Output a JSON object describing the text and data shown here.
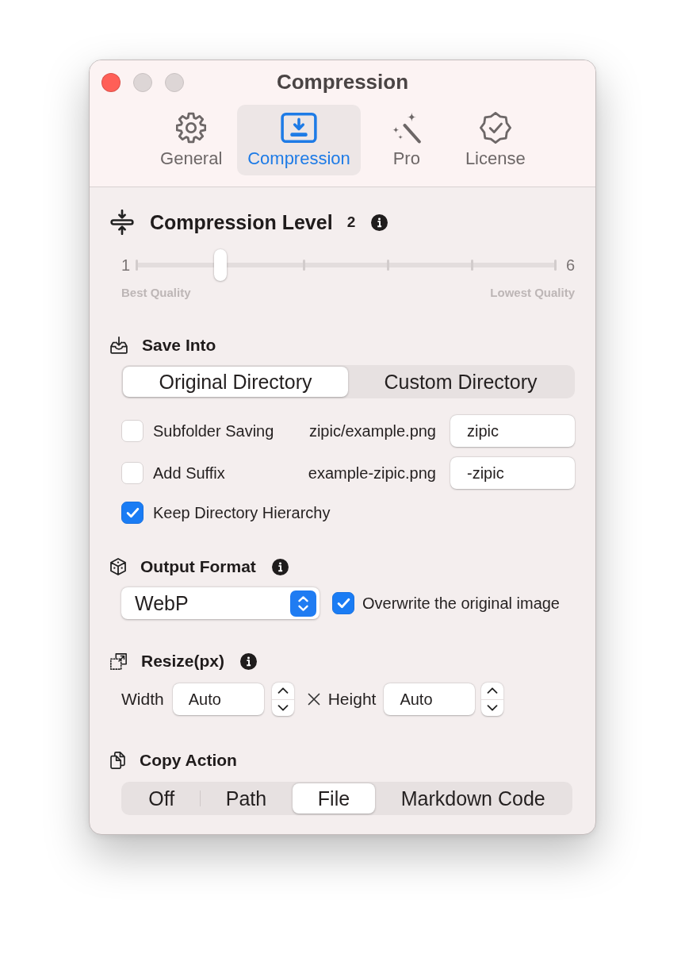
{
  "window": {
    "title": "Compression",
    "controls": [
      {
        "kind": "close",
        "disabled": false
      },
      {
        "kind": "minimize",
        "disabled": true
      },
      {
        "kind": "zoom",
        "disabled": true
      }
    ]
  },
  "tabs": [
    {
      "label": "General",
      "selected": false
    },
    {
      "label": "Compression",
      "selected": true
    },
    {
      "label": "Pro",
      "selected": false
    },
    {
      "label": "License",
      "selected": false
    }
  ],
  "compression_level": {
    "title": "Compression Level",
    "value": "2",
    "min_label": "1",
    "max_label": "6",
    "level": 0.2,
    "min_caption": "Best Quality",
    "max_caption": "Lowest Quality"
  },
  "save_into": {
    "title": "Save Into",
    "segments": [
      {
        "label": "Original Directory",
        "selected": true
      },
      {
        "label": "Custom Directory",
        "selected": false
      }
    ],
    "options": [
      {
        "label": "Subfolder Saving",
        "checked": false,
        "example": "zipic/example.png",
        "value": "zipic"
      },
      {
        "label": "Add Suffix",
        "checked": false,
        "example": "example-zipic.png",
        "value": "-zipic"
      },
      {
        "label": "Keep Directory Hierarchy",
        "checked": true
      }
    ]
  },
  "output_format": {
    "title": "Output Format",
    "format": "WebP",
    "overwrite": {
      "label": "Overwrite the original image",
      "checked": true
    }
  },
  "resize": {
    "title": "Resize(px)",
    "width": {
      "label": "Width",
      "value": "Auto"
    },
    "height": {
      "label": "Height",
      "value": "Auto"
    }
  },
  "copy_action": {
    "title": "Copy Action",
    "segments": [
      {
        "label": "Off",
        "selected": false
      },
      {
        "label": "Path",
        "selected": false
      },
      {
        "label": "File",
        "selected": true
      },
      {
        "label": "Markdown Code",
        "selected": false
      }
    ]
  }
}
